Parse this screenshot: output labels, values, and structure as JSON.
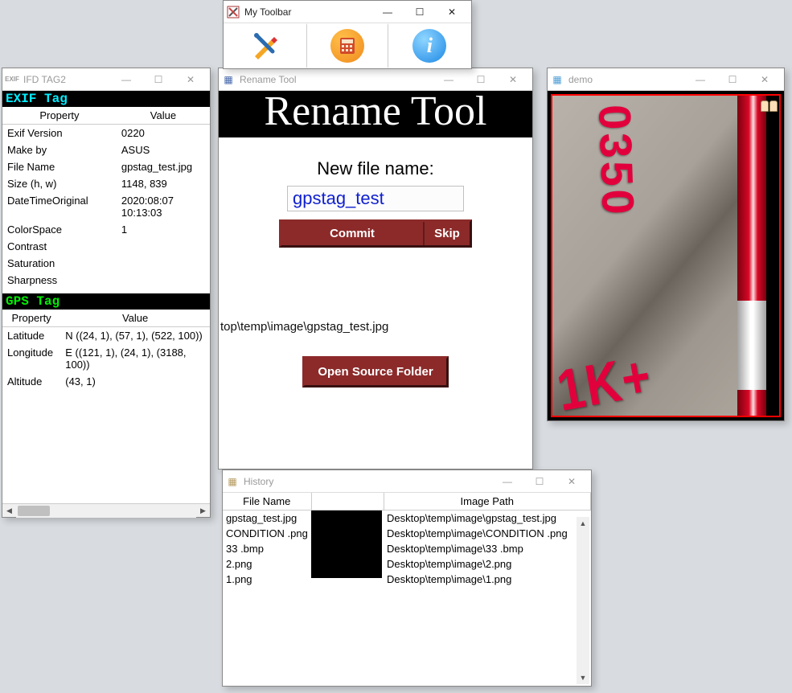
{
  "toolbar": {
    "title": "My Toolbar",
    "buttons": [
      {
        "name": "pencil-tool",
        "icon": "pencil"
      },
      {
        "name": "calc-tool",
        "icon": "calc"
      },
      {
        "name": "info-tool",
        "icon": "info"
      }
    ]
  },
  "exif": {
    "title": "IFD TAG2",
    "section1_label": "EXIF Tag",
    "section1_headers": {
      "prop": "Property",
      "val": "Value"
    },
    "section1_rows": [
      {
        "prop": "Exif Version",
        "val": "0220"
      },
      {
        "prop": "Make by",
        "val": "ASUS"
      },
      {
        "prop": "File Name",
        "val": "gpstag_test.jpg"
      },
      {
        "prop": "Size (h, w)",
        "val": "1148, 839"
      },
      {
        "prop": "DateTimeOriginal",
        "val": "2020:08:07 10:13:03"
      },
      {
        "prop": "ColorSpace",
        "val": "1"
      },
      {
        "prop": "Contrast",
        "val": ""
      },
      {
        "prop": "Saturation",
        "val": ""
      },
      {
        "prop": "Sharpness",
        "val": ""
      }
    ],
    "section2_label": "GPS Tag",
    "section2_headers": {
      "prop": "Property",
      "val": "Value"
    },
    "section2_rows": [
      {
        "prop": "Latitude",
        "val": "N ((24, 1), (57, 1), (522, 100))"
      },
      {
        "prop": "Longitude",
        "val": "E ((121, 1), (24, 1), (3188, 100))"
      },
      {
        "prop": "Altitude",
        "val": "(43, 1)"
      }
    ]
  },
  "rename": {
    "title": "Rename Tool",
    "big_title": "Rename Tool",
    "label": "New file name:",
    "input_value": "gpstag_test",
    "commit_label": "Commit",
    "skip_label": "Skip",
    "source_path": "top\\temp\\image\\gpstag_test.jpg",
    "open_folder_label": "Open Source Folder"
  },
  "demo": {
    "title": "demo",
    "spray_text_1": "0350",
    "spray_text_2": "1K+"
  },
  "history": {
    "title": "History",
    "headers": {
      "file": "File Name",
      "thumb": "",
      "path": "Image Path"
    },
    "rows": [
      {
        "file": "gpstag_test.jpg",
        "path": "Desktop\\temp\\image\\gpstag_test.jpg"
      },
      {
        "file": "CONDITION .png",
        "path": "Desktop\\temp\\image\\CONDITION .png"
      },
      {
        "file": "33 .bmp",
        "path": "Desktop\\temp\\image\\33 .bmp"
      },
      {
        "file": "2.png",
        "path": "Desktop\\temp\\image\\2.png"
      },
      {
        "file": "1.png",
        "path": "Desktop\\temp\\image\\1.png"
      }
    ]
  },
  "win_btns": {
    "min": "—",
    "max": "☐",
    "close": "✕"
  }
}
